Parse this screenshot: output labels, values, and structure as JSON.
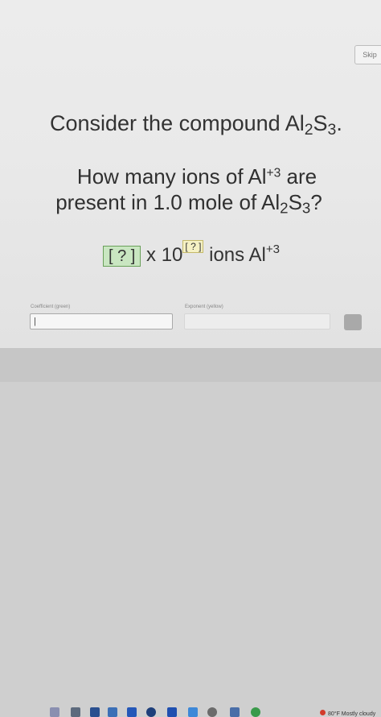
{
  "header": {
    "skip_label": "Skip"
  },
  "question": {
    "line1_prefix": "Consider the compound Al",
    "line1_sub1": "2",
    "line1_mid": "S",
    "line1_sub2": "3",
    "line1_suffix": ".",
    "q_line1_a": "How many ions of Al",
    "q_line1_sup": "+3",
    "q_line1_b": " are",
    "q_line2_a": "present in 1.0 mole of Al",
    "q_line2_sub1": "2",
    "q_line2_mid": "S",
    "q_line2_sub2": "3",
    "q_line2_b": "?"
  },
  "expression": {
    "coefficient_placeholder": "?",
    "times_ten": " x 10",
    "exponent_placeholder": "?",
    "ions_label": " ions Al",
    "ion_charge": "+3"
  },
  "fields": {
    "coefficient_label": "Coefficient (green)",
    "coefficient_value": "|",
    "exponent_label": "Exponent (yellow)",
    "exponent_value": ""
  },
  "taskbar": {
    "weather_text": "80°F  Mostly cloudy",
    "icons": [
      "teams-icon",
      "app-icon",
      "calculator-icon",
      "mail-icon",
      "media-icon",
      "photos-icon",
      "word-icon",
      "settings-icon",
      "chrome-icon"
    ]
  }
}
